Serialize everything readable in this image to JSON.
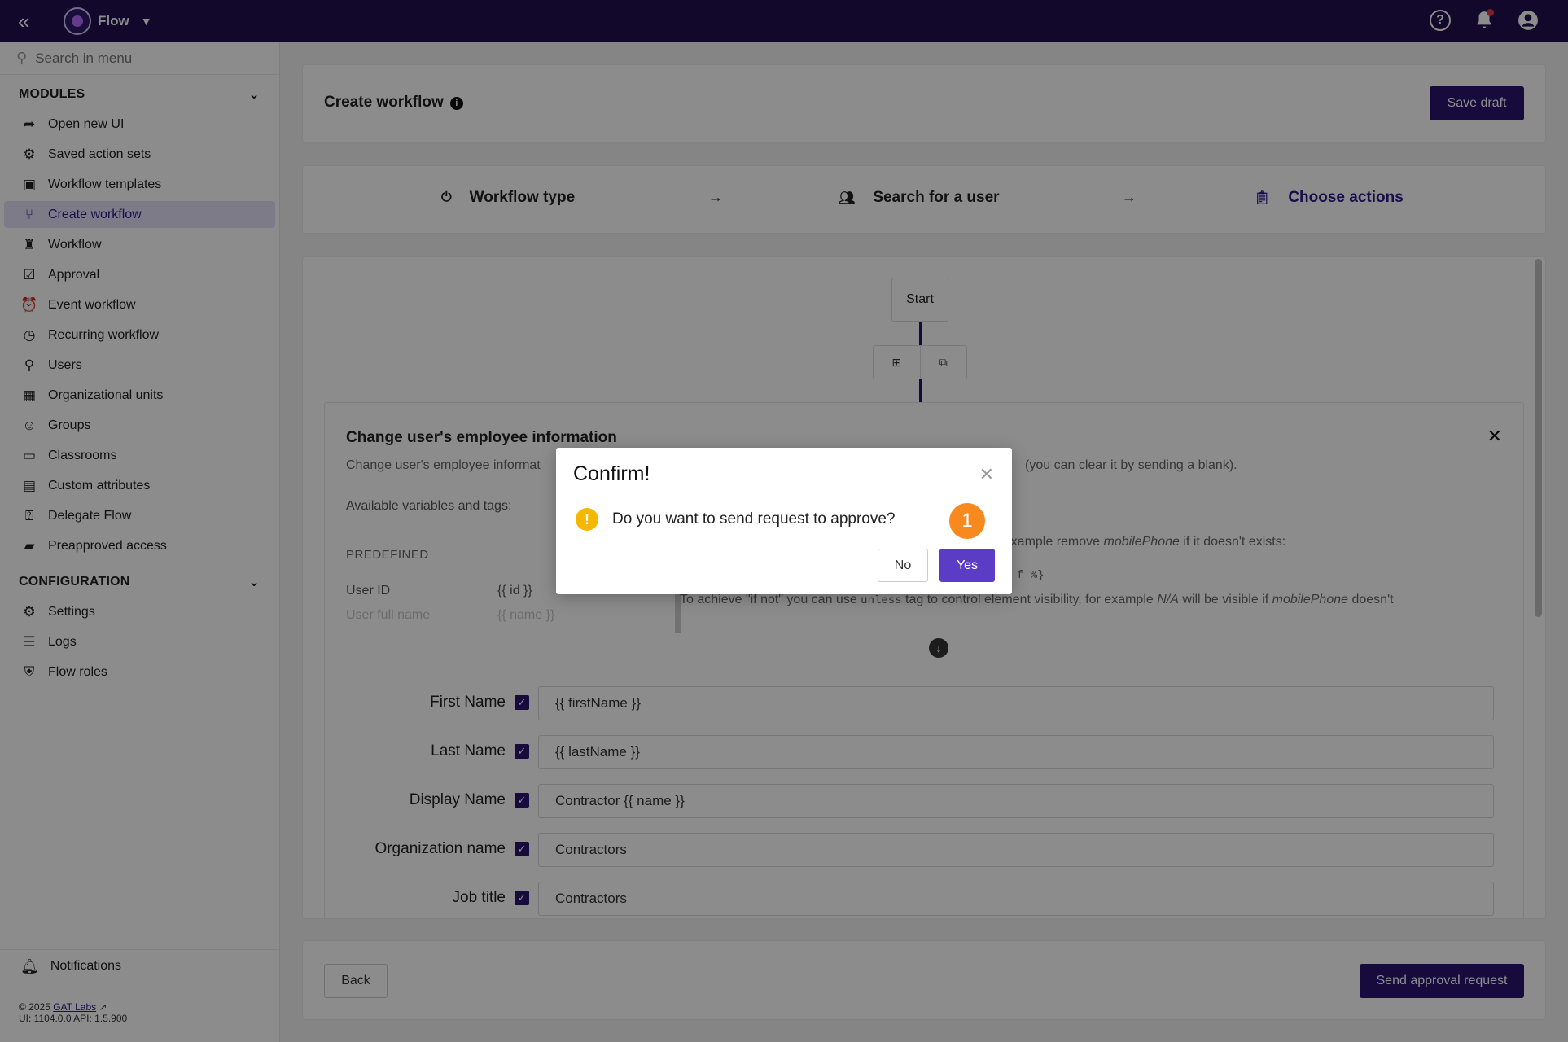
{
  "topbar": {
    "app_name": "Flow"
  },
  "sidebar": {
    "search_placeholder": "Search in menu",
    "modules_title": "MODULES",
    "modules": [
      {
        "label": "Open new UI",
        "icon": "share-arrow-icon"
      },
      {
        "label": "Saved action sets",
        "icon": "gears-icon"
      },
      {
        "label": "Workflow templates",
        "icon": "template-icon"
      },
      {
        "label": "Create workflow",
        "icon": "branch-icon",
        "active": true
      },
      {
        "label": "Workflow",
        "icon": "sitemap-icon"
      },
      {
        "label": "Approval",
        "icon": "checklist-icon"
      },
      {
        "label": "Event workflow",
        "icon": "alarm-icon"
      },
      {
        "label": "Recurring workflow",
        "icon": "clock-icon"
      },
      {
        "label": "Users",
        "icon": "user-search-icon"
      },
      {
        "label": "Organizational units",
        "icon": "building-icon"
      },
      {
        "label": "Groups",
        "icon": "group-icon"
      },
      {
        "label": "Classrooms",
        "icon": "classroom-icon"
      },
      {
        "label": "Custom attributes",
        "icon": "table-icon"
      },
      {
        "label": "Delegate Flow",
        "icon": "user-question-icon"
      },
      {
        "label": "Preapproved access",
        "icon": "pass-icon"
      }
    ],
    "configuration_title": "CONFIGURATION",
    "configuration": [
      {
        "label": "Settings",
        "icon": "gear-icon"
      },
      {
        "label": "Logs",
        "icon": "list-icon"
      },
      {
        "label": "Flow roles",
        "icon": "shield-icon"
      }
    ],
    "notifications_label": "Notifications",
    "footer_copyright": "© 2025",
    "footer_link": "GAT Labs",
    "footer_version": "UI: 1104.0.0 API: 1.5.900"
  },
  "header": {
    "title": "Create workflow",
    "save_draft": "Save draft"
  },
  "steps": [
    {
      "label": "Workflow type",
      "icon": "power-icon"
    },
    {
      "label": "Search for a user",
      "icon": "users-icon"
    },
    {
      "label": "Choose actions",
      "icon": "clipboard-icon",
      "current": true
    }
  ],
  "flow": {
    "start_label": "Start"
  },
  "action": {
    "title": "Change user's employee information",
    "desc_left": "Change user's employee informat",
    "desc_right": "(you can clear it by sending a blank).",
    "vars_label": "Available variables and tags:",
    "predefined_label": "PREDEFINED",
    "vars": [
      {
        "name": "User ID",
        "tag": "{{ id }}"
      },
      {
        "name": "User full name",
        "tag": "{{ name }}"
      }
    ],
    "help_line1_prefix": "r example remove",
    "help_line1_var": "mobilePhone",
    "help_line1_suffix": "if it doesn't exists:",
    "help_line2_code": "f %}",
    "help_line3_a": "To achieve \"if not\" you can use",
    "help_line3_code": "unless",
    "help_line3_b": "tag to control element visibility, for example",
    "help_line3_na": "N/A",
    "help_line3_c": "will be visible if",
    "help_line3_var": "mobilePhone",
    "help_line3_d": "doesn't",
    "fields": [
      {
        "label": "First Name",
        "value": "{{ firstName }}"
      },
      {
        "label": "Last Name",
        "value": "{{ lastName }}"
      },
      {
        "label": "Display Name",
        "value": "Contractor {{ name }}"
      },
      {
        "label": "Organization name",
        "value": "Contractors"
      },
      {
        "label": "Job title",
        "value": "Contractors"
      }
    ]
  },
  "footer": {
    "back": "Back",
    "send": "Send approval request"
  },
  "modal": {
    "title": "Confirm!",
    "message": "Do you want to send request to approve?",
    "badge": "1",
    "no": "No",
    "yes": "Yes"
  }
}
